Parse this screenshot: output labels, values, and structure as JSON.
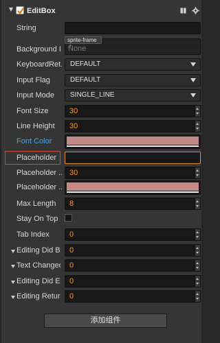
{
  "component": {
    "title": "EditBox",
    "enabled": true
  },
  "properties": {
    "string": {
      "label": "String",
      "value": ""
    },
    "background_image": {
      "label": "Background I...",
      "tag": "sprite-frame",
      "placeholder": "None"
    },
    "keyboard_return": {
      "label": "KeyboardRet...",
      "value": "DEFAULT"
    },
    "input_flag": {
      "label": "Input Flag",
      "value": "DEFAULT"
    },
    "input_mode": {
      "label": "Input Mode",
      "value": "SINGLE_LINE"
    },
    "font_size": {
      "label": "Font Size",
      "value": "30"
    },
    "line_height": {
      "label": "Line Height",
      "value": "30"
    },
    "font_color": {
      "label": "Font Color",
      "color": "#c48a8a"
    },
    "placeholder": {
      "label": "Placeholder",
      "value": ""
    },
    "placeholder_font_size": {
      "label": "Placeholder ...",
      "value": "30"
    },
    "placeholder_font_color": {
      "label": "Placeholder ...",
      "color": "#c48a8a"
    },
    "max_length": {
      "label": "Max Length",
      "value": "8"
    },
    "stay_on_top": {
      "label": "Stay On Top",
      "checked": false
    },
    "tab_index": {
      "label": "Tab Index",
      "value": "0"
    }
  },
  "events": [
    {
      "label": "Editing Did B...",
      "value": "0"
    },
    {
      "label": "Text Changed",
      "value": "0"
    },
    {
      "label": "Editing Did E...",
      "value": "0"
    },
    {
      "label": "Editing Return",
      "value": "0"
    }
  ],
  "add_component_label": "添加组件",
  "colors": {
    "accent_orange": "#ff9a1c",
    "link_blue": "#4aa6e8",
    "highlight_red": "#d24a3c"
  }
}
